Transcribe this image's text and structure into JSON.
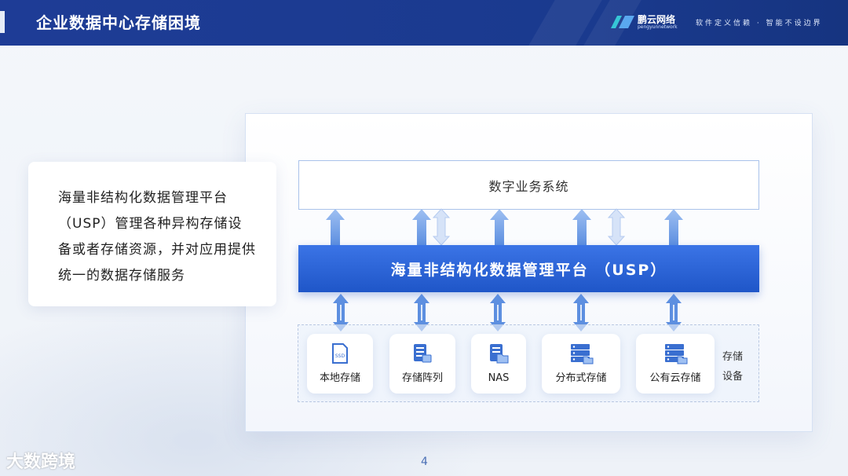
{
  "header": {
    "title": "企业数据中心存储困境",
    "brand_name": "鹏云网络",
    "brand_sub": "pengyunnetwork",
    "slogan": "软件定义信赖 · 智能不设边界"
  },
  "description": {
    "text": "海量非结构化数据管理平台（USP）管理各种异构存储设备或者存储资源，并对应用提供统一的数据存储服务"
  },
  "diagram": {
    "business_system": "数字业务系统",
    "platform": "海量非结构化数据管理平台 （USP）",
    "storage_label": "存储设备",
    "storage_items": [
      {
        "label": "本地存储",
        "icon": "ssd-icon"
      },
      {
        "label": "存储阵列",
        "icon": "storage-array-icon"
      },
      {
        "label": "NAS",
        "icon": "nas-icon"
      },
      {
        "label": "分布式存储",
        "icon": "distributed-storage-icon"
      },
      {
        "label": "公有云存储",
        "icon": "public-cloud-storage-icon"
      }
    ]
  },
  "footer": {
    "page_number": "4",
    "watermark": "大数跨境"
  },
  "colors": {
    "header_bg": "#1e3c96",
    "platform_bar": "#2a62d6",
    "arrow": "#7aa3e6"
  }
}
